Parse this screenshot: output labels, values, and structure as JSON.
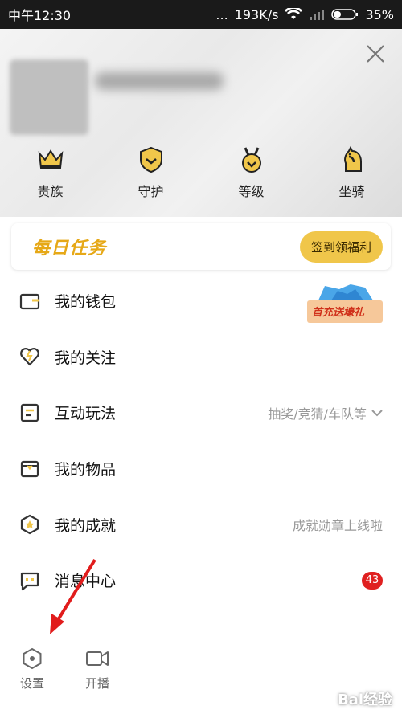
{
  "status": {
    "time": "中午12:30",
    "dots": "...",
    "speed": "193K/s",
    "battery": "35%"
  },
  "header": {
    "perks": [
      {
        "label": "贵族",
        "icon": "crown-icon"
      },
      {
        "label": "守护",
        "icon": "shield-icon"
      },
      {
        "label": "等级",
        "icon": "medal-icon"
      },
      {
        "label": "坐骑",
        "icon": "horse-icon"
      }
    ]
  },
  "task": {
    "brand": "每日任务",
    "button": "签到领福利"
  },
  "menu": [
    {
      "label": "我的钱包",
      "icon": "wallet-icon",
      "promo": "首充送壕礼"
    },
    {
      "label": "我的关注",
      "icon": "heart-icon"
    },
    {
      "label": "互动玩法",
      "icon": "list-icon",
      "extra": "抽奖/竞猜/车队等"
    },
    {
      "label": "我的物品",
      "icon": "box-icon"
    },
    {
      "label": "我的成就",
      "icon": "star-badge-icon",
      "extra": "成就勋章上线啦"
    },
    {
      "label": "消息中心",
      "icon": "message-icon",
      "badge": "43"
    }
  ],
  "bottom": {
    "settings": "设置",
    "broadcast": "开播"
  },
  "watermark": "Bai经验",
  "colors": {
    "accent": "#f0c64a",
    "badge": "#e02020",
    "arrow": "#e11c1c"
  }
}
